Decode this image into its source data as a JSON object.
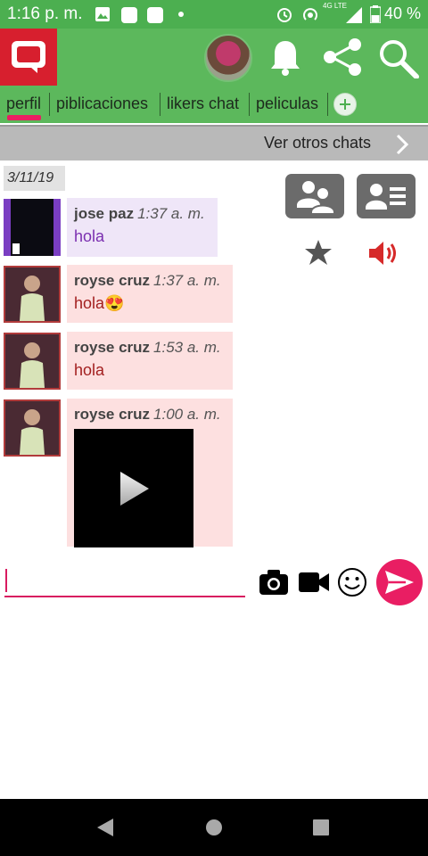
{
  "status_bar": {
    "time": "1:16 p. m.",
    "network_label": "4G LTE",
    "battery": "40 %"
  },
  "app_bar": {
    "logo_icon": "chat-bubble-icon",
    "icons": [
      "bell-icon",
      "share-icon",
      "search-icon"
    ]
  },
  "tabs": [
    {
      "label": "perfil",
      "active": true
    },
    {
      "label": "piblicaciones",
      "active": false
    },
    {
      "label": "likers chat",
      "active": false
    },
    {
      "label": "peliculas",
      "active": false
    }
  ],
  "other_chats": {
    "label": "Ver otros chats"
  },
  "date": "3/11/19",
  "messages": [
    {
      "name": "jose paz",
      "time": "1:37 a. m.",
      "text": "hola"
    },
    {
      "name": "royse cruz",
      "time": "1:37 a. m.",
      "text": "hola😍"
    },
    {
      "name": "royse cruz",
      "time": "1:53 a. m.",
      "text": "hola"
    },
    {
      "name": "royse cruz",
      "time": "1:00 a. m.",
      "text": ""
    }
  ],
  "composer": {
    "value": "",
    "placeholder": ""
  },
  "colors": {
    "app_green": "#5cb85c",
    "accent_pink": "#e91e63",
    "logo_red": "#d71f2e",
    "bubble_purple": "#efe6f8",
    "bubble_pink": "#fde0e0"
  }
}
